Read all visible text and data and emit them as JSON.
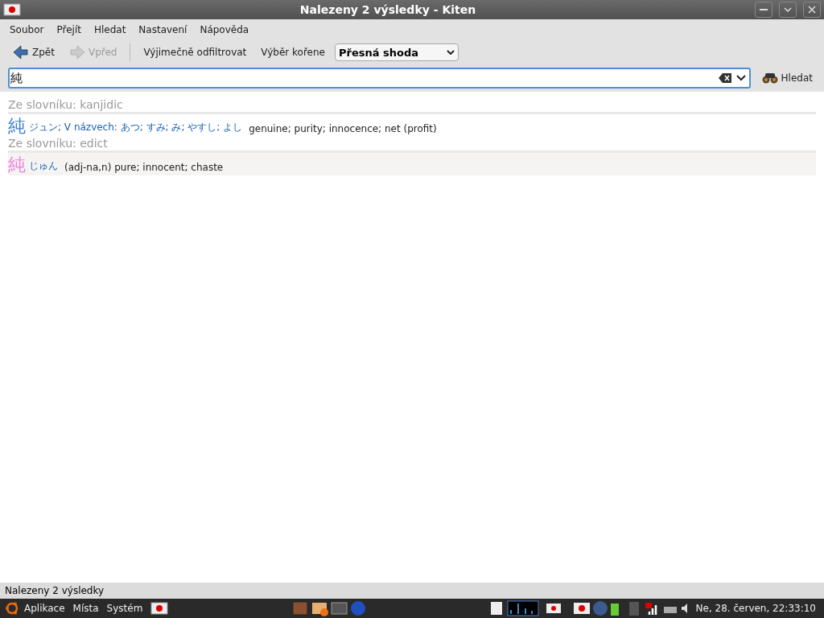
{
  "window": {
    "title": "Nalezeny 2 výsledky - Kiten"
  },
  "menu": [
    "Soubor",
    "Přejít",
    "Hledat",
    "Nastavení",
    "Nápověda"
  ],
  "toolbar": {
    "back": {
      "label": "Zpět",
      "disabled": false
    },
    "forward": {
      "label": "Vpřed",
      "disabled": true
    },
    "filter": "Výjimečně odfiltrovat",
    "root": "Výběr kořene",
    "mode": "Přesná shoda"
  },
  "search": {
    "value": "純",
    "button": "Hledat"
  },
  "results": [
    {
      "heading": "Ze slovníku: kanjidic",
      "kanji": "純",
      "color": "#3a7fd0",
      "highlighted": false,
      "reading": "ジュン; V názvech: あつ; すみ; み; やすし; よし",
      "meaning": "genuine; purity; innocence; net (profit)"
    },
    {
      "heading": "Ze slovníku: edict",
      "kanji": "純",
      "color": "#f080e0",
      "highlighted": true,
      "reading": "じゅん",
      "meaning": "(adj-na,n) pure; innocent; chaste"
    }
  ],
  "status_bar": "Nalezeny 2 výsledky",
  "panel": {
    "menus": [
      "Aplikace",
      "Místa",
      "Systém"
    ],
    "clock": "Ne, 28. červen, 22:33:10"
  }
}
